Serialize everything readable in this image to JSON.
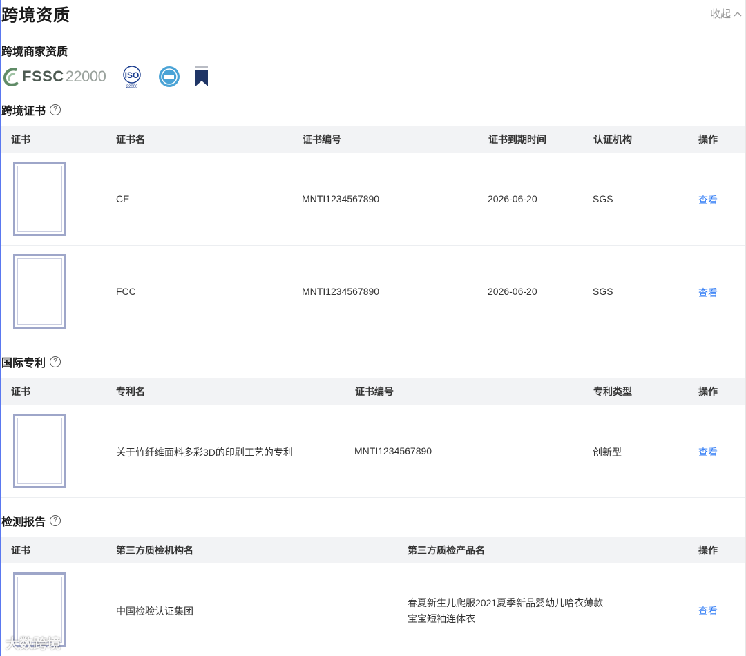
{
  "header": {
    "title": "跨境资质",
    "collapse_label": "收起"
  },
  "merchant": {
    "title": "跨境商家资质",
    "logos": [
      "fssc-22000-logo",
      "iso-22000-logo",
      "bds-logo",
      "brand-badge-logo"
    ],
    "fssc_text": "FSSC",
    "fssc_num": "22000",
    "iso_text": "ISO",
    "iso_num": "22000"
  },
  "certs": {
    "title": "跨境证书",
    "columns": [
      "证书",
      "证书名",
      "证书编号",
      "证书到期时间",
      "认证机构",
      "操作"
    ],
    "rows": [
      {
        "name": "CE",
        "number": "MNTI1234567890",
        "expiry": "2026-06-20",
        "authority": "SGS",
        "action": "查看"
      },
      {
        "name": "FCC",
        "number": "MNTI1234567890",
        "expiry": "2026-06-20",
        "authority": "SGS",
        "action": "查看"
      }
    ]
  },
  "patents": {
    "title": "国际专利",
    "columns": [
      "证书",
      "专利名",
      "证书编号",
      "专利类型",
      "操作"
    ],
    "rows": [
      {
        "name": "关于竹纤维面料多彩3D的印刷工艺的专利",
        "number": "MNTI1234567890",
        "type": "创新型",
        "action": "查看"
      }
    ]
  },
  "reports": {
    "title": "检测报告",
    "columns": [
      "证书",
      "第三方质检机构名",
      "第三方质检产品名",
      "操作"
    ],
    "rows": [
      {
        "institution": "中国检验认证集团",
        "product_line1": "春夏新生儿爬服2021夏季新品婴幼儿哈衣薄款",
        "product_line2": "宝宝短袖连体衣",
        "action": "查看"
      }
    ]
  },
  "colors": {
    "accent": "#2f7bf5",
    "header_bg": "#f2f3f5",
    "left_rule": "#5a78f0"
  },
  "watermark": "大数跨境"
}
